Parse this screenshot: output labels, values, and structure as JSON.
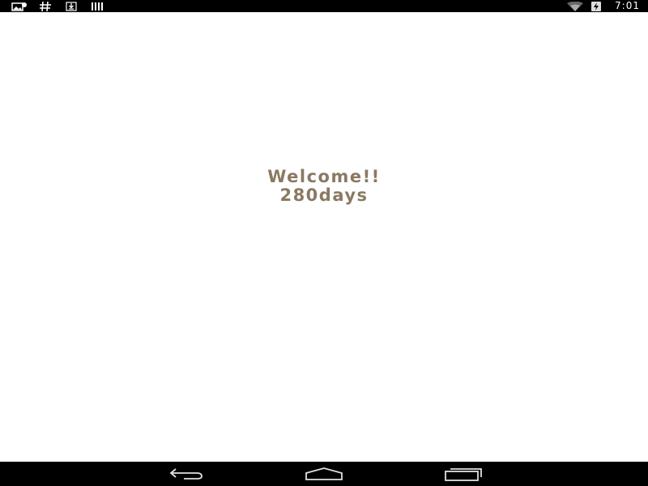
{
  "status_bar": {
    "time": "7:01",
    "left_icons": [
      "gallery-notification-icon",
      "hash-icon",
      "download-icon",
      "barcode-icon"
    ],
    "right_icons": [
      "wifi-icon",
      "battery-charging-icon"
    ]
  },
  "splash": {
    "line1": "Welcome!!",
    "line2": "280days",
    "text_color": "#8a7a62"
  },
  "nav_bar": {
    "buttons": [
      "back-icon",
      "home-icon",
      "recent-apps-icon"
    ]
  }
}
